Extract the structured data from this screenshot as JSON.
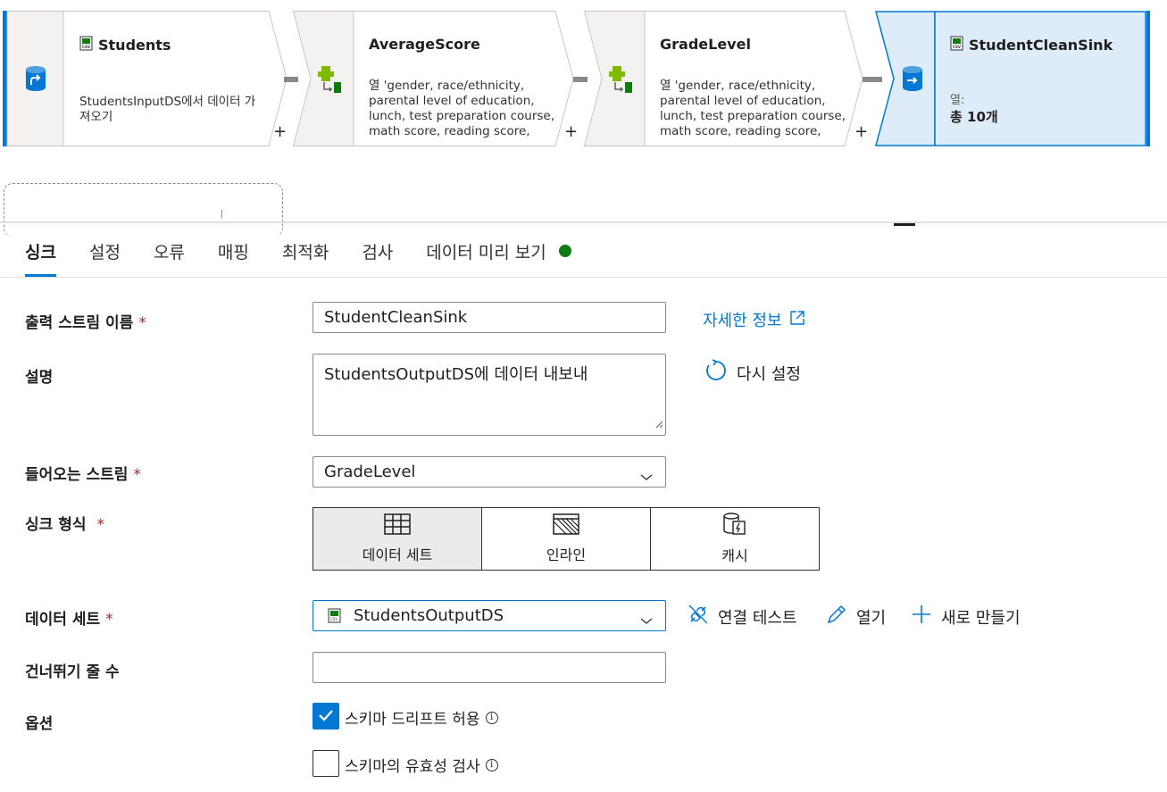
{
  "flow": {
    "nodes": [
      {
        "title": "Students",
        "description": "StudentsInputDS에서 데이터 가져오기"
      },
      {
        "title": "AverageScore",
        "description": "열 'gender, race/ethnicity, parental level of education, lunch, test preparation course, math score, reading score,"
      },
      {
        "title": "GradeLevel",
        "description": "열 'gender, race/ethnicity, parental level of education, lunch, test preparation course, math score, reading score,"
      },
      {
        "title": "StudentCleanSink",
        "columns_label": "열:",
        "columns_value": "총 10개"
      }
    ],
    "plus": "+"
  },
  "tabs": [
    {
      "label": "싱크",
      "active": true
    },
    {
      "label": "설정"
    },
    {
      "label": "오류"
    },
    {
      "label": "매핑"
    },
    {
      "label": "최적화"
    },
    {
      "label": "검사"
    },
    {
      "label": "데이터 미리 보기",
      "status_color": "#107c10"
    }
  ],
  "form": {
    "output_stream": {
      "label": "출력 스트림 이름",
      "required": "*",
      "value": "StudentCleanSink"
    },
    "learn_more": "자세한 정보",
    "description": {
      "label": "설명",
      "value": "StudentsOutputDS에 데이터 내보내"
    },
    "reset": "다시 설정",
    "incoming_stream": {
      "label": "들어오는 스트림",
      "required": "*",
      "value": "GradeLevel"
    },
    "sink_type": {
      "label": "싱크 형식",
      "required": "*",
      "options": [
        {
          "label": "데이터 세트",
          "icon": "table-icon",
          "selected": true
        },
        {
          "label": "인라인",
          "icon": "inline-icon"
        },
        {
          "label": "캐시",
          "icon": "cache-icon"
        }
      ]
    },
    "dataset": {
      "label": "데이터 세트",
      "required": "*",
      "value": "StudentsOutputDS"
    },
    "test_connection": "연결 테스트",
    "open": "열기",
    "new": "새로 만들기",
    "skip_lines": {
      "label": "건너뛰기 줄 수",
      "value": ""
    },
    "options": {
      "label": "옵션",
      "allow_schema_drift": {
        "label": "스키마 드리프트 허용",
        "checked": true
      },
      "validate_schema": {
        "label": "스키마의 유효성 검사",
        "checked": false
      }
    }
  },
  "colors": {
    "accent": "#0078d4",
    "success": "#107c10",
    "required": "#a4262c"
  }
}
